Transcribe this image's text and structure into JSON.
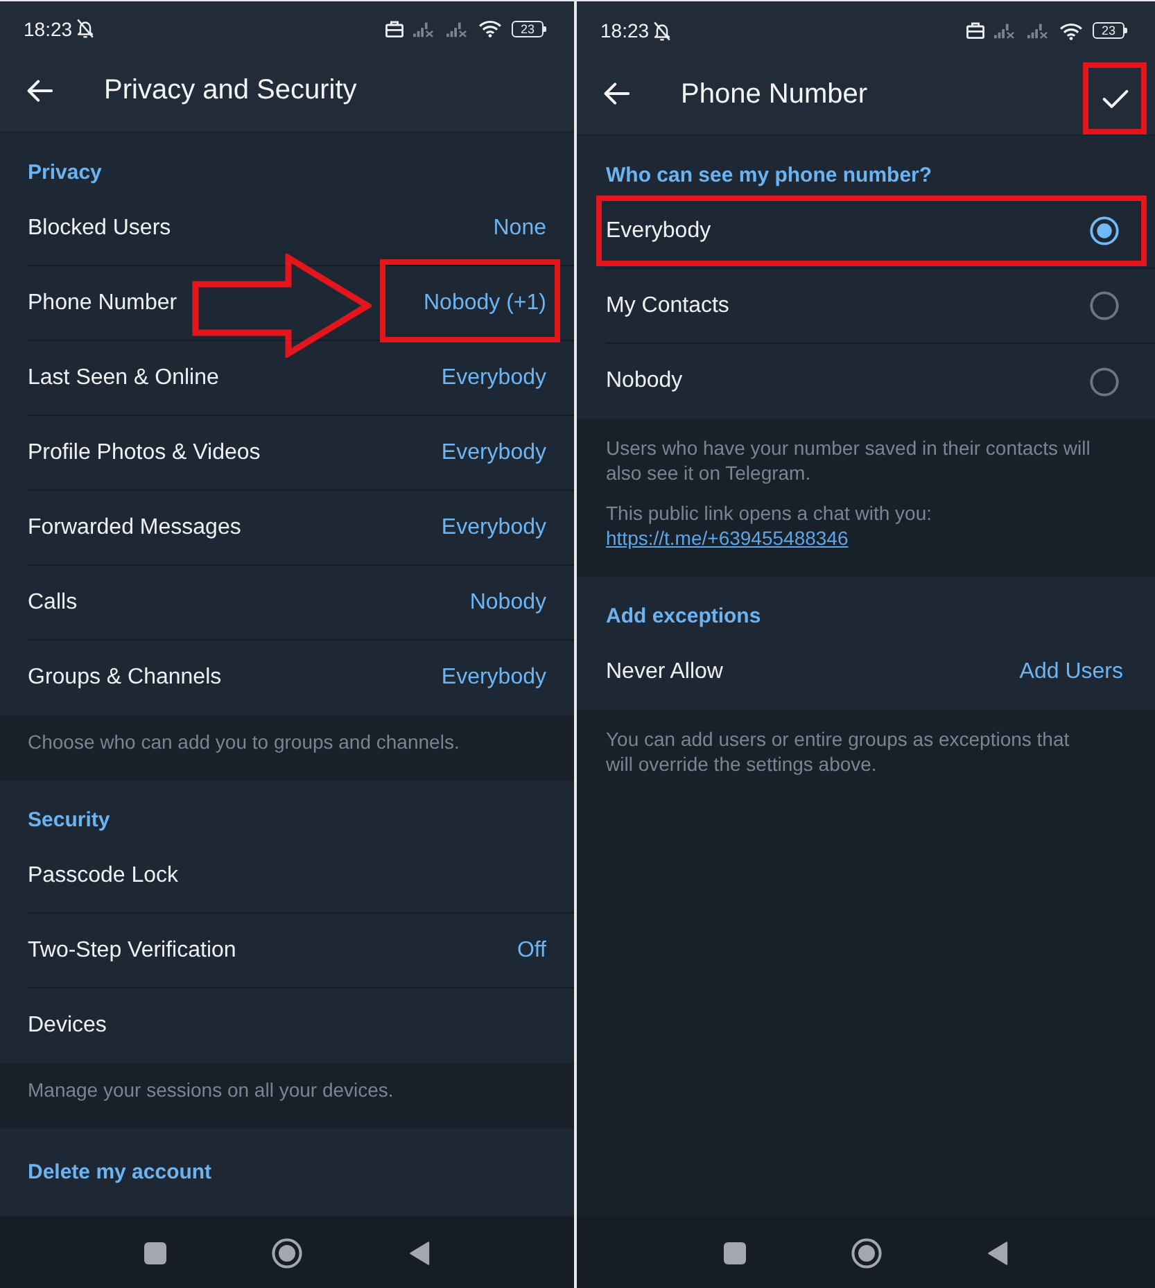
{
  "screens": [
    {
      "kind": "settings_list",
      "status_bar": {
        "time": "18:23",
        "battery": "23"
      },
      "header": {
        "title": "Privacy and Security"
      },
      "annotation_arrow": true,
      "sections": [
        {
          "kind": "group",
          "title": "Privacy",
          "rows": [
            {
              "kind": "value",
              "label": "Blocked Users",
              "value": "None",
              "highlighted": false
            },
            {
              "kind": "value",
              "label": "Phone Number",
              "value": "Nobody (+1)",
              "highlighted": true
            },
            {
              "kind": "value",
              "label": "Last Seen & Online",
              "value": "Everybody",
              "highlighted": false
            },
            {
              "kind": "value",
              "label": "Profile Photos & Videos",
              "value": "Everybody",
              "highlighted": false
            },
            {
              "kind": "value",
              "label": "Forwarded Messages",
              "value": "Everybody",
              "highlighted": false
            },
            {
              "kind": "value",
              "label": "Calls",
              "value": "Nobody",
              "highlighted": false
            },
            {
              "kind": "value",
              "label": "Groups & Channels",
              "value": "Everybody",
              "highlighted": false
            }
          ]
        },
        {
          "kind": "info",
          "paragraphs": [
            "Choose who can add you to groups and channels."
          ]
        },
        {
          "kind": "group",
          "title": "Security",
          "rows": [
            {
              "kind": "value",
              "label": "Passcode Lock",
              "highlighted": false
            },
            {
              "kind": "value",
              "label": "Two-Step Verification",
              "value": "Off",
              "highlighted": false
            },
            {
              "kind": "value",
              "label": "Devices",
              "highlighted": false
            }
          ]
        },
        {
          "kind": "info",
          "paragraphs": [
            "Manage your sessions on all your devices."
          ]
        },
        {
          "kind": "action",
          "label": "Delete my account"
        }
      ]
    },
    {
      "kind": "detail",
      "status_bar": {
        "time": "18:23",
        "battery": "23"
      },
      "header": {
        "title": "Phone Number",
        "done_button": {
          "highlighted": true
        }
      },
      "sections": [
        {
          "kind": "group",
          "title": "Who can see my phone number?",
          "rows": [
            {
              "kind": "radio",
              "label": "Everybody",
              "selected": true,
              "highlighted": true
            },
            {
              "kind": "radio",
              "label": "My Contacts",
              "selected": false,
              "highlighted": false
            },
            {
              "kind": "radio",
              "label": "Nobody",
              "selected": false,
              "highlighted": false
            }
          ]
        },
        {
          "kind": "info",
          "paragraphs": [
            "Users who have your number saved in their contacts will also see it on Telegram.",
            "This public link opens a chat with you:"
          ],
          "link": "https://t.me/+639455488346"
        },
        {
          "kind": "group",
          "title": "Add exceptions",
          "rows": [
            {
              "kind": "value",
              "label": "Never Allow",
              "value": "Add Users",
              "highlighted": false
            }
          ]
        },
        {
          "kind": "info",
          "paragraphs": [
            "You can add users or entire groups as exceptions that will override the settings above."
          ]
        }
      ]
    }
  ]
}
